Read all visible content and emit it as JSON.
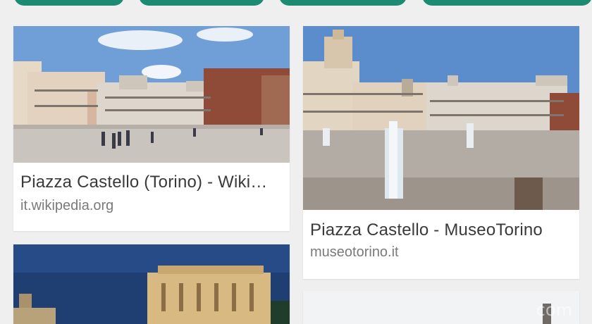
{
  "results": [
    {
      "title": "Piazza Castello (Torino) - Wiki…",
      "source": "it.wikipedia.org"
    },
    {
      "title": "Piazza Castello - MuseoTorino",
      "source": "museotorino.it"
    }
  ],
  "watermark": "com",
  "colors": {
    "accent": "#1d8a72",
    "background": "#efefef",
    "card": "#ffffff"
  }
}
